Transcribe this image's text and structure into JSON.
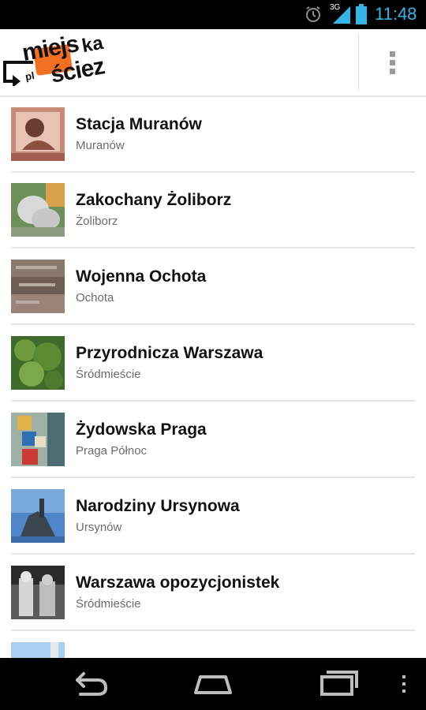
{
  "status_bar": {
    "network_type": "3G",
    "time": "11:48",
    "icons": [
      "alarm-icon",
      "signal-icon",
      "battery-icon"
    ],
    "accent_color": "#33b5e5"
  },
  "action_bar": {
    "logo_text": {
      "line1": "miejs",
      "line1_suffix": "ka",
      "line2": "ściez",
      "domain": "pl"
    },
    "brand_color": "#f36f21",
    "overflow_icon": "overflow-menu-icon"
  },
  "routes": [
    {
      "title": "Stacja Muranów",
      "subtitle": "Muranów",
      "thumb_icon": "route-thumbnail"
    },
    {
      "title": "Zakochany Żoliborz",
      "subtitle": "Żoliborz",
      "thumb_icon": "route-thumbnail"
    },
    {
      "title": "Wojenna Ochota",
      "subtitle": "Ochota",
      "thumb_icon": "route-thumbnail"
    },
    {
      "title": "Przyrodnicza Warszawa",
      "subtitle": "Śródmieście",
      "thumb_icon": "route-thumbnail"
    },
    {
      "title": "Żydowska Praga",
      "subtitle": "Praga Północ",
      "thumb_icon": "route-thumbnail"
    },
    {
      "title": "Narodziny Ursynowa",
      "subtitle": "Ursynów",
      "thumb_icon": "route-thumbnail"
    },
    {
      "title": "Warszawa opozycjonistek",
      "subtitle": "Śródmieście",
      "thumb_icon": "route-thumbnail"
    }
  ],
  "nav_bar": {
    "buttons": [
      "back-icon",
      "home-icon",
      "recent-apps-icon",
      "menu-icon"
    ]
  }
}
